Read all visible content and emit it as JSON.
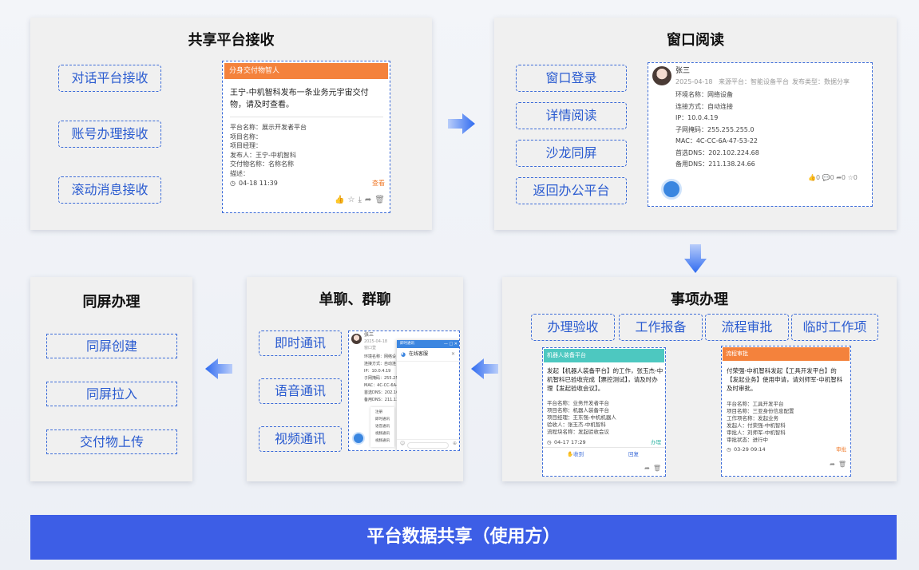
{
  "panels": {
    "receive": {
      "title": "共享平台接收",
      "items": [
        "对话平台接收",
        "账号办理接收",
        "滚动消息接收"
      ],
      "card": {
        "header": "分身交付物智人",
        "message": "王宁-中机智科发布一条业务元宇宙交付物，请及时查看。",
        "fields": [
          "平台名称：展示开发者平台",
          "项目名称：",
          "项目经理：",
          "发布人：王宁-中机智科",
          "交付物名称：名称名称",
          "描述："
        ],
        "time": "04-18 11:39",
        "action": "查看"
      }
    },
    "window": {
      "title": "窗口阅读",
      "items": [
        "窗口登录",
        "详情阅读",
        "沙龙同屏",
        "返回办公平台"
      ],
      "card": {
        "name": "张三",
        "date": "2025-04-18",
        "source": "来源平台：智能设备平台",
        "type": "发布类型：数据分享",
        "fields": [
          "环境名称：网络设备",
          "连接方式：自动连接",
          "IP：10.0.4.19",
          "子网掩码：255.255.255.0",
          "MAC：4C-CC-6A-47-53-22",
          "首选DNS：202.102.224.68",
          "备用DNS：211.138.24.66"
        ],
        "stats": [
          "0",
          "0",
          "0",
          "0"
        ]
      }
    },
    "handle": {
      "title": "事项办理",
      "tabs": [
        "办理验收",
        "工作报备",
        "流程审批",
        "临时工作项"
      ],
      "card1": {
        "header": "机器人装备平台",
        "message": "发起【机器人装备平台】的工作，张玉杰-中机智科已验收完成【票控测试】，请及时办理【发起验收会议】。",
        "fields": [
          "平台名称：业务开发者平台",
          "项目名称：机器人装备平台",
          "项目经理：王东强-中机机器人",
          "验收人：张玉杰-中机智科",
          "流程块名称：发起验收会议"
        ],
        "time": "04-17 17:29",
        "status": "办理",
        "btn1": "收到",
        "btn2": "回复"
      },
      "card2": {
        "header": "流程审批",
        "message": "付荣强-中机智科发起【工具开发平台】的【发起业务】使用申请，请刘师军-中机智科及时审批。",
        "fields": [
          "平台名称：工具开发平台",
          "项目名称：三亚身份信息配置",
          "工作项名称：发起业务",
          "发起人：付荣强-中机智科",
          "审批人：刘师军-中机智科",
          "审批状态：进行中"
        ],
        "time": "03-29 09:14",
        "status": "审批"
      }
    },
    "chat": {
      "title": "单聊、群聊",
      "items": [
        "即时通讯",
        "语音通讯",
        "视频通讯"
      ],
      "popup_header": "即时通讯",
      "popup_status": "在线客服",
      "menu": [
        "注册",
        "即时通讯",
        "语音通讯",
        "视频通讯",
        "视频通讯"
      ],
      "card_name": "张三",
      "card_date": "2025-04-18",
      "card_sub": "窗口登",
      "fields": [
        "环境名称：网络设",
        "连接方式：自动连",
        "IP：10.0.4.19",
        "子网掩码：255.25",
        "MAC：4C-CC-6A-4",
        "首选DNS：202.102.",
        "备用DNS：211.138."
      ]
    },
    "screen": {
      "title": "同屏办理",
      "items": [
        "同屏创建",
        "同屏拉入",
        "交付物上传"
      ]
    }
  },
  "banner": "平台数据共享（使用方）",
  "colors": {
    "accent": "#3d5ee6",
    "dashed": "#3b6bd8",
    "orange": "#f4823c",
    "teal": "#4dc8c0"
  }
}
